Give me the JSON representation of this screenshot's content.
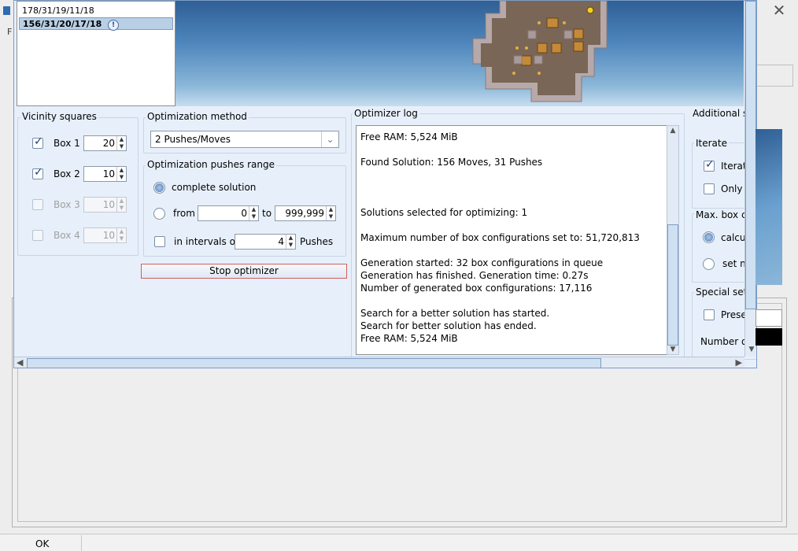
{
  "background": {
    "ok_label": "OK"
  },
  "solutions": {
    "items": [
      {
        "label": "178/31/19/11/18",
        "selected": false
      },
      {
        "label": "156/31/20/17/18",
        "selected": true
      }
    ],
    "info_icon": "!"
  },
  "vicinity": {
    "title": "Vicinity squares",
    "boxes": [
      {
        "label": "Box 1",
        "value": "20",
        "checked": true,
        "enabled": true
      },
      {
        "label": "Box 2",
        "value": "10",
        "checked": true,
        "enabled": true
      },
      {
        "label": "Box 3",
        "value": "10",
        "checked": false,
        "enabled": false
      },
      {
        "label": "Box 4",
        "value": "10",
        "checked": false,
        "enabled": false
      }
    ]
  },
  "method": {
    "title": "Optimization method",
    "selected": "2 Pushes/Moves"
  },
  "range": {
    "title": "Optimization pushes range",
    "complete_label": "complete solution",
    "from_label": "from",
    "from_value": "0",
    "to_label": "to",
    "to_value": "999,999",
    "intervals_label": "in intervals of",
    "intervals_value": "4",
    "pushes_label": "Pushes"
  },
  "stop_button": "Stop optimizer",
  "log": {
    "title": "Optimizer log",
    "lines": [
      "Free RAM: 5,524 MiB",
      "Found Solution: 156 Moves, 31 Pushes",
      "Solutions selected for optimizing: 1",
      "Maximum number of box configurations set to: 51,720,813",
      "Generation started: 32 box configurations in queue",
      "Generation has finished. Generation time: 0.27s",
      "Number of generated box configurations: 17,116",
      "Search for a better solution has started.",
      "Search for better solution has ended.",
      "Free RAM: 5,524 MiB"
    ]
  },
  "right": {
    "additional_title": "Additional s",
    "iterate_title": "Iterate",
    "iterate_label": "Iterati",
    "only_label": "Only :",
    "maxbox_title": "Max. box cc",
    "calc_label": "calcu",
    "setn_label": "set n",
    "special_title": "Special set",
    "prese_label": "Prese",
    "number_label": "Number o"
  },
  "colors": {
    "window_bg": "#e7f0fa",
    "accent": "#7b9dc6",
    "stop_border": "#cf5f5f"
  }
}
